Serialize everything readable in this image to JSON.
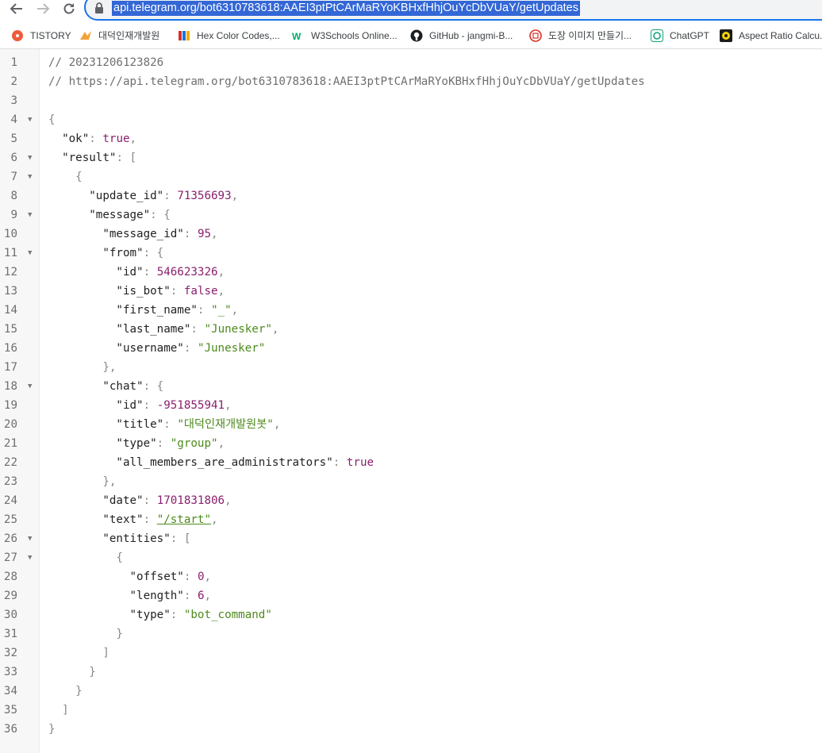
{
  "browser": {
    "url": "api.telegram.org/bot6310783618:AAEI3ptPtCArMaRYoKBHxfHhjOuYcDbVUaY/getUpdates",
    "accent": "#1a73e8",
    "selection_color": "#3367d6"
  },
  "bookmarks": [
    {
      "label": "TISTORY",
      "icon": "tistory-icon"
    },
    {
      "label": "대덕인재개발원",
      "icon": "ddit-icon"
    },
    {
      "label": "Hex Color Codes,...",
      "icon": "hex-color-icon"
    },
    {
      "label": "W3Schools Online...",
      "icon": "w3schools-icon"
    },
    {
      "label": "GitHub - jangmi-B...",
      "icon": "github-icon"
    },
    {
      "label": "도장 이미지 만들기...",
      "icon": "stamp-icon"
    },
    {
      "label": "ChatGPT",
      "icon": "chatgpt-icon"
    },
    {
      "label": "Aspect Ratio Calcu...",
      "icon": "aspect-ratio-icon"
    }
  ],
  "colors": {
    "number": "#8a1f6d",
    "string": "#4d8a1c",
    "punct": "#888888",
    "comment": "#6f6f6f"
  },
  "code": {
    "lines": [
      {
        "n": "1",
        "fold": false,
        "tokens": [
          {
            "t": "// 20231206123826",
            "c": "c"
          }
        ]
      },
      {
        "n": "2",
        "fold": false,
        "tokens": [
          {
            "t": "// https://api.telegram.org/bot6310783618:AAEI3ptPtCArMaRYoKBHxfHhjOuYcDbVUaY/getUpdates",
            "c": "c"
          }
        ]
      },
      {
        "n": "3",
        "fold": false,
        "tokens": []
      },
      {
        "n": "4",
        "fold": true,
        "tokens": [
          {
            "t": "{",
            "c": "p"
          }
        ]
      },
      {
        "n": "5",
        "fold": false,
        "tokens": [
          {
            "t": "  ",
            "c": "k"
          },
          {
            "t": "\"ok\"",
            "c": "k"
          },
          {
            "t": ": ",
            "c": "p"
          },
          {
            "t": "true",
            "c": "b"
          },
          {
            "t": ",",
            "c": "p"
          }
        ]
      },
      {
        "n": "6",
        "fold": true,
        "tokens": [
          {
            "t": "  ",
            "c": "k"
          },
          {
            "t": "\"result\"",
            "c": "k"
          },
          {
            "t": ": [",
            "c": "p"
          }
        ]
      },
      {
        "n": "7",
        "fold": true,
        "tokens": [
          {
            "t": "    ",
            "c": "k"
          },
          {
            "t": "{",
            "c": "p"
          }
        ]
      },
      {
        "n": "8",
        "fold": false,
        "tokens": [
          {
            "t": "      ",
            "c": "k"
          },
          {
            "t": "\"update_id\"",
            "c": "k"
          },
          {
            "t": ": ",
            "c": "p"
          },
          {
            "t": "71356693",
            "c": "n"
          },
          {
            "t": ",",
            "c": "p"
          }
        ]
      },
      {
        "n": "9",
        "fold": true,
        "tokens": [
          {
            "t": "      ",
            "c": "k"
          },
          {
            "t": "\"message\"",
            "c": "k"
          },
          {
            "t": ": {",
            "c": "p"
          }
        ]
      },
      {
        "n": "10",
        "fold": false,
        "tokens": [
          {
            "t": "        ",
            "c": "k"
          },
          {
            "t": "\"message_id\"",
            "c": "k"
          },
          {
            "t": ": ",
            "c": "p"
          },
          {
            "t": "95",
            "c": "n"
          },
          {
            "t": ",",
            "c": "p"
          }
        ]
      },
      {
        "n": "11",
        "fold": true,
        "tokens": [
          {
            "t": "        ",
            "c": "k"
          },
          {
            "t": "\"from\"",
            "c": "k"
          },
          {
            "t": ": {",
            "c": "p"
          }
        ]
      },
      {
        "n": "12",
        "fold": false,
        "tokens": [
          {
            "t": "          ",
            "c": "k"
          },
          {
            "t": "\"id\"",
            "c": "k"
          },
          {
            "t": ": ",
            "c": "p"
          },
          {
            "t": "546623326",
            "c": "n"
          },
          {
            "t": ",",
            "c": "p"
          }
        ]
      },
      {
        "n": "13",
        "fold": false,
        "tokens": [
          {
            "t": "          ",
            "c": "k"
          },
          {
            "t": "\"is_bot\"",
            "c": "k"
          },
          {
            "t": ": ",
            "c": "p"
          },
          {
            "t": "false",
            "c": "b"
          },
          {
            "t": ",",
            "c": "p"
          }
        ]
      },
      {
        "n": "14",
        "fold": false,
        "tokens": [
          {
            "t": "          ",
            "c": "k"
          },
          {
            "t": "\"first_name\"",
            "c": "k"
          },
          {
            "t": ": ",
            "c": "p"
          },
          {
            "t": "\"_\"",
            "c": "s"
          },
          {
            "t": ",",
            "c": "p"
          }
        ]
      },
      {
        "n": "15",
        "fold": false,
        "tokens": [
          {
            "t": "          ",
            "c": "k"
          },
          {
            "t": "\"last_name\"",
            "c": "k"
          },
          {
            "t": ": ",
            "c": "p"
          },
          {
            "t": "\"Junesker\"",
            "c": "s"
          },
          {
            "t": ",",
            "c": "p"
          }
        ]
      },
      {
        "n": "16",
        "fold": false,
        "tokens": [
          {
            "t": "          ",
            "c": "k"
          },
          {
            "t": "\"username\"",
            "c": "k"
          },
          {
            "t": ": ",
            "c": "p"
          },
          {
            "t": "\"Junesker\"",
            "c": "s"
          }
        ]
      },
      {
        "n": "17",
        "fold": false,
        "tokens": [
          {
            "t": "        ",
            "c": "k"
          },
          {
            "t": "},",
            "c": "p"
          }
        ]
      },
      {
        "n": "18",
        "fold": true,
        "tokens": [
          {
            "t": "        ",
            "c": "k"
          },
          {
            "t": "\"chat\"",
            "c": "k"
          },
          {
            "t": ": {",
            "c": "p"
          }
        ]
      },
      {
        "n": "19",
        "fold": false,
        "tokens": [
          {
            "t": "          ",
            "c": "k"
          },
          {
            "t": "\"id\"",
            "c": "k"
          },
          {
            "t": ": ",
            "c": "p"
          },
          {
            "t": "-951855941",
            "c": "n"
          },
          {
            "t": ",",
            "c": "p"
          }
        ]
      },
      {
        "n": "20",
        "fold": false,
        "tokens": [
          {
            "t": "          ",
            "c": "k"
          },
          {
            "t": "\"title\"",
            "c": "k"
          },
          {
            "t": ": ",
            "c": "p"
          },
          {
            "t": "\"대덕인재개발원봇\"",
            "c": "s"
          },
          {
            "t": ",",
            "c": "p"
          }
        ]
      },
      {
        "n": "21",
        "fold": false,
        "tokens": [
          {
            "t": "          ",
            "c": "k"
          },
          {
            "t": "\"type\"",
            "c": "k"
          },
          {
            "t": ": ",
            "c": "p"
          },
          {
            "t": "\"group\"",
            "c": "s"
          },
          {
            "t": ",",
            "c": "p"
          }
        ]
      },
      {
        "n": "22",
        "fold": false,
        "tokens": [
          {
            "t": "          ",
            "c": "k"
          },
          {
            "t": "\"all_members_are_administrators\"",
            "c": "k"
          },
          {
            "t": ": ",
            "c": "p"
          },
          {
            "t": "true",
            "c": "b"
          }
        ]
      },
      {
        "n": "23",
        "fold": false,
        "tokens": [
          {
            "t": "        ",
            "c": "k"
          },
          {
            "t": "},",
            "c": "p"
          }
        ]
      },
      {
        "n": "24",
        "fold": false,
        "tokens": [
          {
            "t": "        ",
            "c": "k"
          },
          {
            "t": "\"date\"",
            "c": "k"
          },
          {
            "t": ": ",
            "c": "p"
          },
          {
            "t": "1701831806",
            "c": "n"
          },
          {
            "t": ",",
            "c": "p"
          }
        ]
      },
      {
        "n": "25",
        "fold": false,
        "tokens": [
          {
            "t": "        ",
            "c": "k"
          },
          {
            "t": "\"text\"",
            "c": "k"
          },
          {
            "t": ": ",
            "c": "p"
          },
          {
            "t": "\"/start\"",
            "c": "s lnk"
          },
          {
            "t": ",",
            "c": "p"
          }
        ]
      },
      {
        "n": "26",
        "fold": true,
        "tokens": [
          {
            "t": "        ",
            "c": "k"
          },
          {
            "t": "\"entities\"",
            "c": "k"
          },
          {
            "t": ": [",
            "c": "p"
          }
        ]
      },
      {
        "n": "27",
        "fold": true,
        "tokens": [
          {
            "t": "          ",
            "c": "k"
          },
          {
            "t": "{",
            "c": "p"
          }
        ]
      },
      {
        "n": "28",
        "fold": false,
        "tokens": [
          {
            "t": "            ",
            "c": "k"
          },
          {
            "t": "\"offset\"",
            "c": "k"
          },
          {
            "t": ": ",
            "c": "p"
          },
          {
            "t": "0",
            "c": "n"
          },
          {
            "t": ",",
            "c": "p"
          }
        ]
      },
      {
        "n": "29",
        "fold": false,
        "tokens": [
          {
            "t": "            ",
            "c": "k"
          },
          {
            "t": "\"length\"",
            "c": "k"
          },
          {
            "t": ": ",
            "c": "p"
          },
          {
            "t": "6",
            "c": "n"
          },
          {
            "t": ",",
            "c": "p"
          }
        ]
      },
      {
        "n": "30",
        "fold": false,
        "tokens": [
          {
            "t": "            ",
            "c": "k"
          },
          {
            "t": "\"type\"",
            "c": "k"
          },
          {
            "t": ": ",
            "c": "p"
          },
          {
            "t": "\"bot_command\"",
            "c": "s"
          }
        ]
      },
      {
        "n": "31",
        "fold": false,
        "tokens": [
          {
            "t": "          ",
            "c": "k"
          },
          {
            "t": "}",
            "c": "p"
          }
        ]
      },
      {
        "n": "32",
        "fold": false,
        "tokens": [
          {
            "t": "        ",
            "c": "k"
          },
          {
            "t": "]",
            "c": "p"
          }
        ]
      },
      {
        "n": "33",
        "fold": false,
        "tokens": [
          {
            "t": "      ",
            "c": "k"
          },
          {
            "t": "}",
            "c": "p"
          }
        ]
      },
      {
        "n": "34",
        "fold": false,
        "tokens": [
          {
            "t": "    ",
            "c": "k"
          },
          {
            "t": "}",
            "c": "p"
          }
        ]
      },
      {
        "n": "35",
        "fold": false,
        "tokens": [
          {
            "t": "  ",
            "c": "k"
          },
          {
            "t": "]",
            "c": "p"
          }
        ]
      },
      {
        "n": "36",
        "fold": false,
        "tokens": [
          {
            "t": "}",
            "c": "p"
          }
        ]
      }
    ]
  }
}
